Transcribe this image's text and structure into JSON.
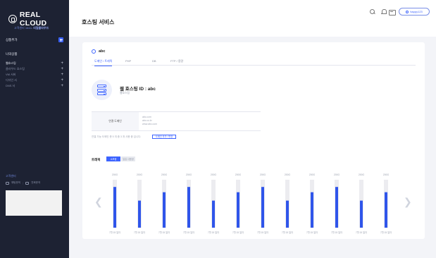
{
  "sidebar": {
    "logo_text": "REAL CLOUD",
    "subline_prefix": "고객센터 1644-",
    "subline_strong": "리얼클라우드",
    "nav_top_label": "상품추가",
    "section_label": "나의상품",
    "items": [
      {
        "label": "웹호스팅"
      },
      {
        "label": "클라우드 호스팅"
      },
      {
        "label": "VM 서버"
      },
      {
        "label": "디자인 서"
      },
      {
        "label": "DNS 서"
      }
    ],
    "cs_title": "고객센터",
    "cs_left": "채팅문의",
    "cs_right": "전화문의"
  },
  "header": {
    "title": "호스팅 서비스",
    "user_label": "happy123",
    "icons": [
      "search-icon",
      "bell-icon",
      "document-icon"
    ]
  },
  "service": {
    "name": "abc",
    "tabs": [
      {
        "label": "도메인 / 트래픽"
      },
      {
        "label": "PHP"
      },
      {
        "label": "DB"
      },
      {
        "label": "FTP / 용량"
      }
    ],
    "title": "웹 호스팅 ID : abc",
    "subtitle": "웹호스팅"
  },
  "domain_info": {
    "label": "연결 도메인",
    "values": [
      "abc.com",
      "abc.co.kr",
      "www.abc.com"
    ],
    "note": "연결 가능 도메인 총 5 개 중 3 개 사용 중 입니다.",
    "add_button": "도메인 추가 / 변경"
  },
  "traffic": {
    "label": "트래픽",
    "btn_active": "소모량",
    "btn_inactive": "일일 사용량"
  },
  "chart_data": {
    "type": "bar",
    "categories": [
      "7월 15 일자",
      "7월 15 일자",
      "7월 15 일자",
      "7월 15 일자",
      "7월 15 일자",
      "7월 15 일자",
      "7월 15 일자",
      "7월 15 일자",
      "7월 15 일자",
      "7월 15 일자",
      "7월 15 일자",
      "7월 15 일자"
    ],
    "top_labels": [
      "200G",
      "200G",
      "200G",
      "200G",
      "200G",
      "200G",
      "200G",
      "200G",
      "200G",
      "200G",
      "200G",
      "200G"
    ],
    "values": [
      170,
      113,
      148,
      170,
      113,
      148,
      170,
      113,
      148,
      170,
      113,
      148
    ],
    "max": 200,
    "colors": {
      "bar": "#2f55ea",
      "track": "#ececf0",
      "label": "#9aa0ae"
    }
  }
}
